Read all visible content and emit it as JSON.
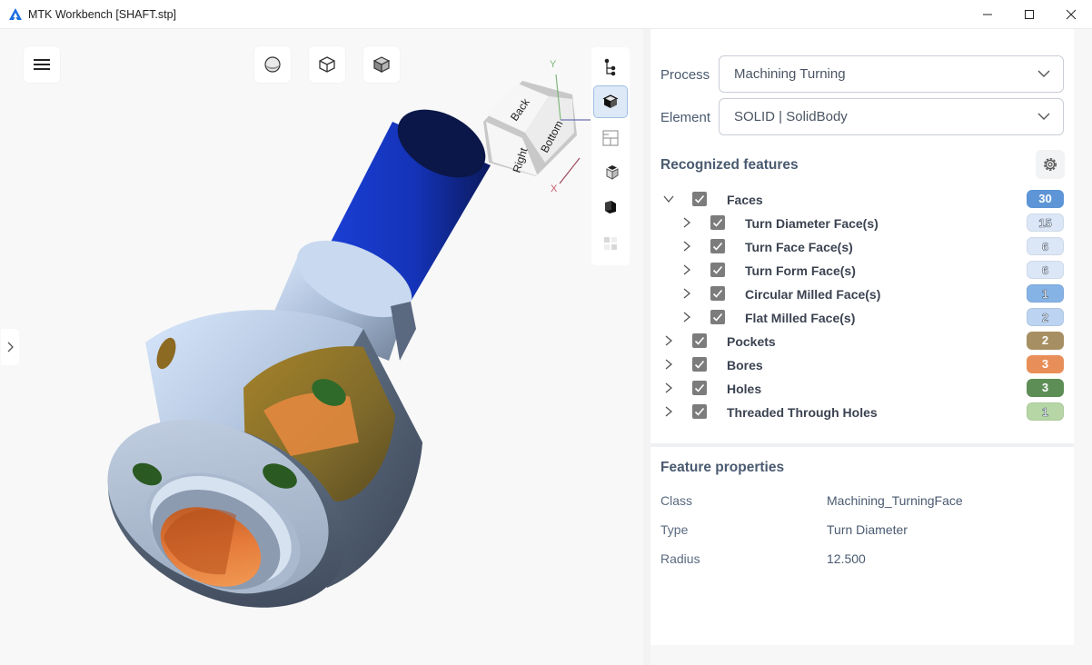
{
  "window": {
    "title": "MTK Workbench [SHAFT.stp]"
  },
  "viewport": {
    "toolbar_icons": [
      "hamburger-menu-icon",
      "sphere-shading-icon",
      "cube-wireframe-icon",
      "cube-shaded-icon"
    ],
    "view_cube": {
      "faces": [
        "Back",
        "Bottom",
        "Right"
      ],
      "axes": [
        "Y",
        "X"
      ]
    },
    "right_toolbar_icons": [
      "tree-structure-icon",
      "cube-view-icon",
      "section-grid-icon",
      "cube-parts-icon",
      "solid-box-icon",
      "tiles-icon"
    ]
  },
  "panel": {
    "process_label": "Process",
    "process_value": "Machining Turning",
    "element_label": "Element",
    "element_value": "SOLID | SolidBody",
    "recognized_title": "Recognized features",
    "tree": [
      {
        "label": "Faces",
        "count": "30",
        "level": 0,
        "expanded": true,
        "badge_color": "#5d95d6"
      },
      {
        "label": "Turn Diameter Face(s)",
        "count": "15",
        "level": 1,
        "badge_color": "#dbe7f7"
      },
      {
        "label": "Turn Face Face(s)",
        "count": "6",
        "level": 1,
        "badge_color": "#dbe7f7"
      },
      {
        "label": "Turn Form Face(s)",
        "count": "6",
        "level": 1,
        "badge_color": "#dbe7f7"
      },
      {
        "label": "Circular Milled Face(s)",
        "count": "1",
        "level": 1,
        "badge_color": "#86b3e5"
      },
      {
        "label": "Flat Milled Face(s)",
        "count": "2",
        "level": 1,
        "badge_color": "#bcd4f1"
      },
      {
        "label": "Pockets",
        "count": "2",
        "level": 0,
        "badge_color": "#a68f62"
      },
      {
        "label": "Bores",
        "count": "3",
        "level": 0,
        "badge_color": "#e88e58"
      },
      {
        "label": "Holes",
        "count": "3",
        "level": 0,
        "badge_color": "#5d8e56"
      },
      {
        "label": "Threaded Through Holes",
        "count": "1",
        "level": 0,
        "badge_color": "#b6d6a6"
      }
    ],
    "properties_title": "Feature properties",
    "properties": [
      {
        "key": "Class",
        "value": "Machining_TurningFace"
      },
      {
        "key": "Type",
        "value": "Turn Diameter"
      },
      {
        "key": "Radius",
        "value": "12.500"
      }
    ]
  }
}
